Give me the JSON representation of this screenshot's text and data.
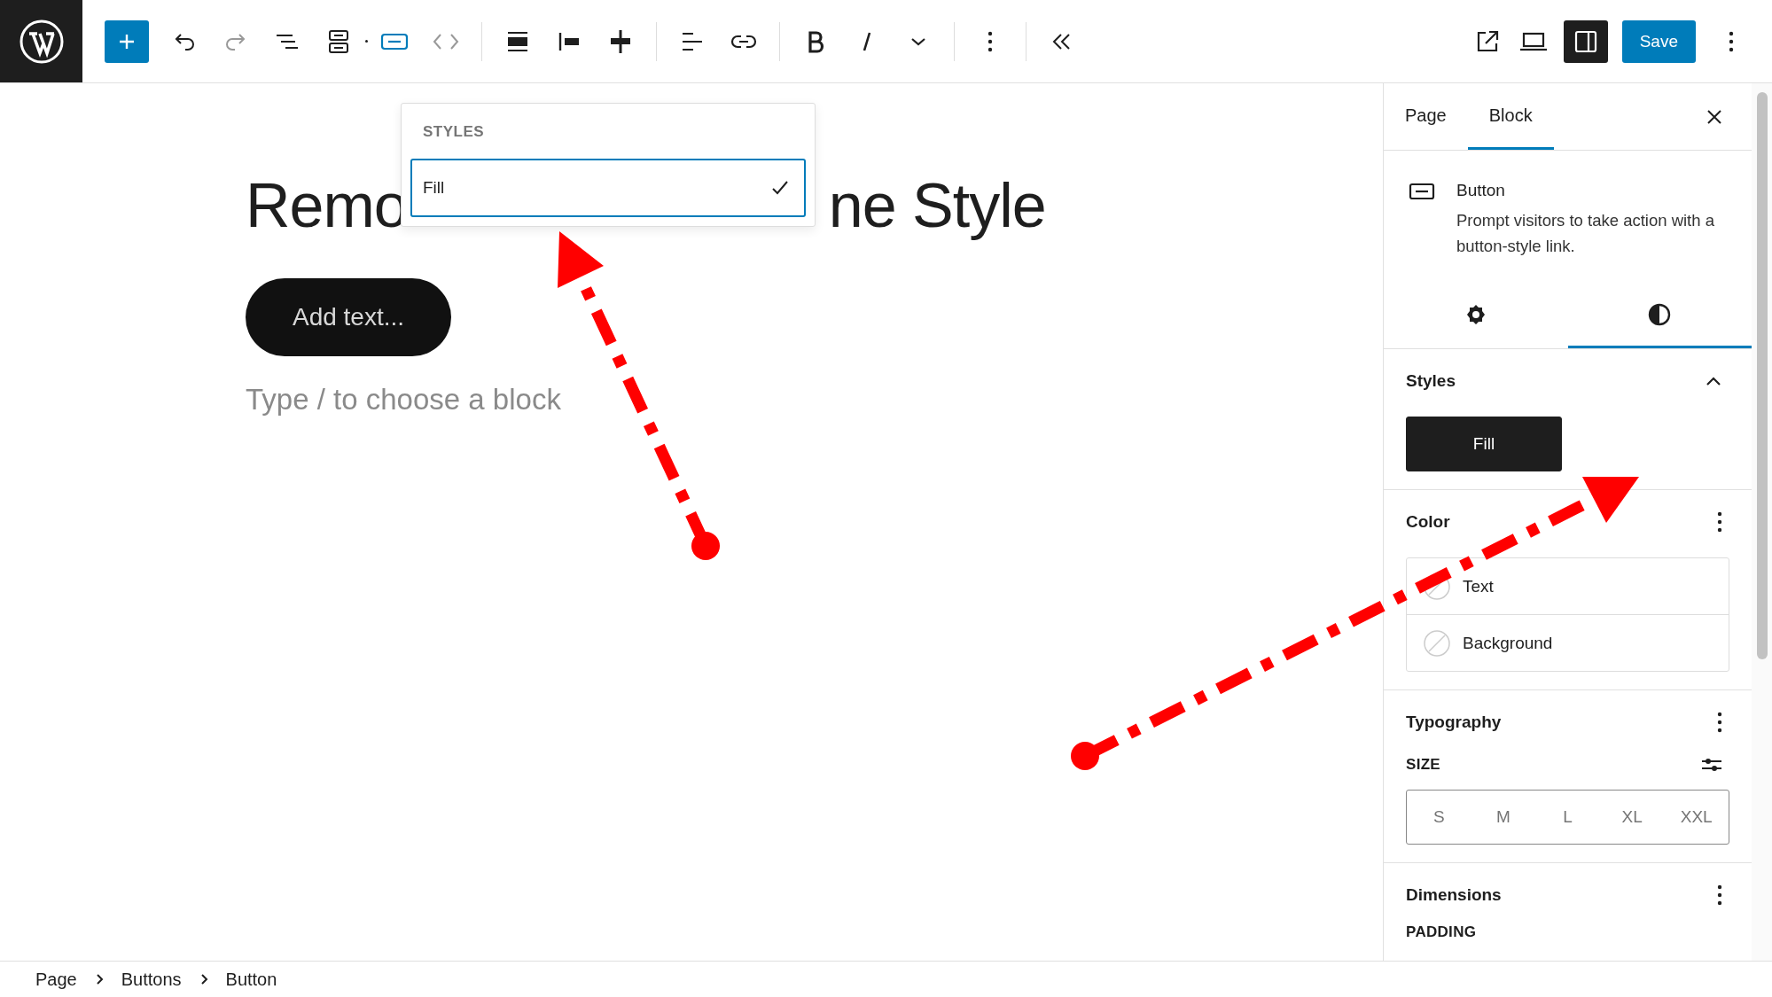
{
  "toolbar": {
    "save_label": "Save",
    "settings_pressed": true
  },
  "canvas": {
    "heading_parts": [
      "Remo",
      "ne Style"
    ],
    "button_text": "Add text...",
    "placeholder": "Type / to choose a block"
  },
  "styles_popover": {
    "heading": "STYLES",
    "options": [
      {
        "label": "Fill",
        "selected": true
      }
    ]
  },
  "sidebar": {
    "tabs": [
      {
        "label": "Page",
        "selected": false
      },
      {
        "label": "Block",
        "selected": true
      }
    ],
    "block": {
      "name": "Button",
      "description": "Prompt visitors to take action with a button-style link."
    },
    "panel_tabs": [
      {
        "kind": "settings",
        "selected": false
      },
      {
        "kind": "styles",
        "selected": true
      }
    ],
    "styles": {
      "title": "Styles",
      "expanded": true,
      "options": [
        {
          "label": "Fill",
          "selected": true
        }
      ]
    },
    "color": {
      "title": "Color",
      "items": [
        {
          "label": "Text"
        },
        {
          "label": "Background"
        }
      ]
    },
    "typography": {
      "title": "Typography",
      "size_label": "SIZE",
      "sizes": [
        {
          "label": "S",
          "selected": false
        },
        {
          "label": "M",
          "selected": false
        },
        {
          "label": "L",
          "selected": false
        },
        {
          "label": "XL",
          "selected": false
        },
        {
          "label": "XXL",
          "selected": false
        }
      ]
    },
    "dimensions": {
      "title": "Dimensions",
      "padding_label": "PADDING"
    }
  },
  "breadcrumb": [
    "Page",
    "Buttons",
    "Button"
  ]
}
